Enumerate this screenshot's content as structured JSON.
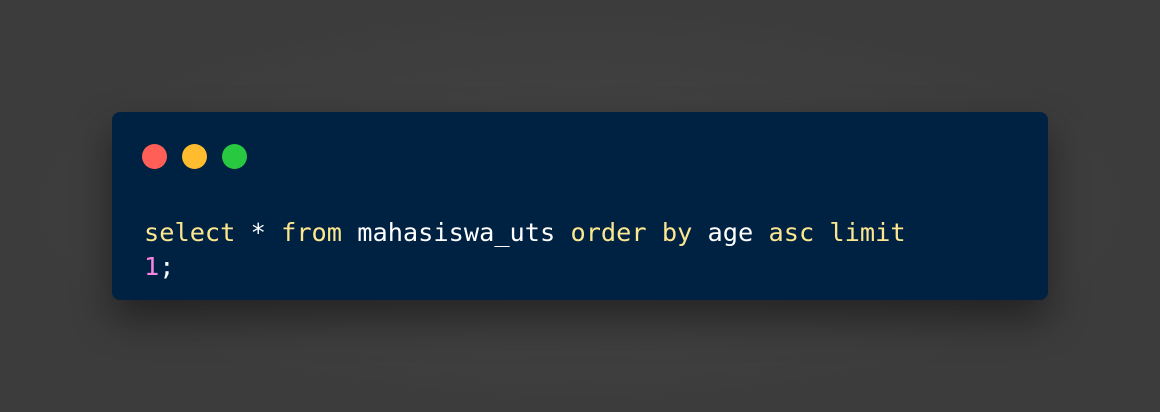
{
  "window": {
    "background": "#002242",
    "controls": [
      {
        "name": "close",
        "color": "#ff5f57"
      },
      {
        "name": "minimize",
        "color": "#febc2e"
      },
      {
        "name": "maximize",
        "color": "#28c840"
      }
    ]
  },
  "colors": {
    "page_background": "#3c3c3c",
    "keyword": "#fce68f",
    "identifier": "#ffffff",
    "number": "#f985e1"
  },
  "code": {
    "language": "sql",
    "line1": {
      "t1": "select",
      "t2": " * ",
      "t3": "from",
      "t4": " mahasiswa_uts ",
      "t5": "order",
      "t6": " ",
      "t7": "by",
      "t8": " age ",
      "t9": "asc",
      "t10": " ",
      "t11": "limit"
    },
    "line2": {
      "t1": "1",
      "t2": ";"
    }
  }
}
